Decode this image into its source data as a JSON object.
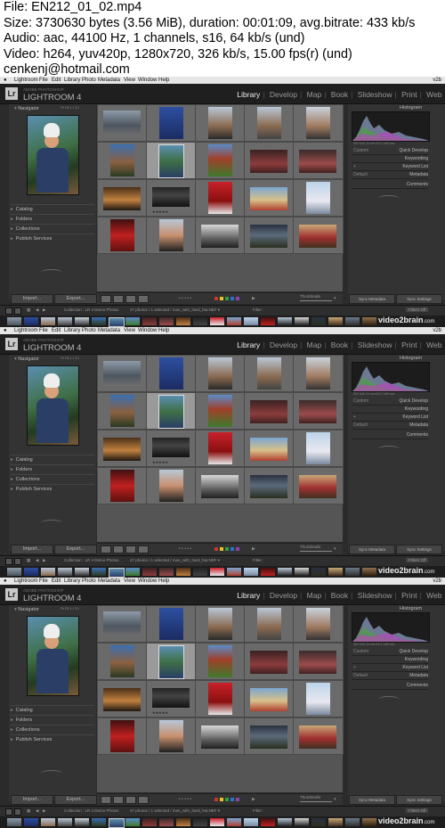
{
  "meta": {
    "lines": [
      "File: EN212_01_02.mp4",
      "Size: 3730630 bytes (3.56 MiB), duration: 00:01:09, avg.bitrate: 433 kb/s",
      "Audio: aac, 44100 Hz, 1 channels, s16, 64 kb/s (und)",
      "Video: h264, yuv420p, 1280x720, 326 kb/s, 15.00 fps(r) (und)",
      "cenkenj@hotmail.com"
    ]
  },
  "menubar": {
    "items": [
      "Lightroom",
      "File",
      "Edit",
      "Library",
      "Photo",
      "Metadata",
      "View",
      "Window",
      "Help"
    ],
    "right_text": "v2b"
  },
  "app": {
    "logo": "Lr",
    "brand_small": "ADOBE PHOTOSHOP",
    "brand": "LIGHTROOM 4",
    "modules": [
      "Library",
      "Develop",
      "Map",
      "Book",
      "Slideshow",
      "Print",
      "Web"
    ],
    "active_module": "Library"
  },
  "left_panel": {
    "navigator": "Navigator",
    "navigator_options": "Fit  Fill  1:1  3:1",
    "sections": [
      "Catalog",
      "Folders",
      "Collections",
      "Publish Services"
    ],
    "import": "Import...",
    "export": "Export..."
  },
  "right_panel": {
    "histogram": "Histogram",
    "histo_info": "ISO 640   24 mm   f/4.0   1/60 sec",
    "preset": "Custom",
    "default": "Default",
    "rows": [
      "Quick Develop",
      "Keywording",
      "Keyword List",
      "Metadata",
      "Comments"
    ],
    "sync_metadata": "Sync Metadata",
    "sync_settings": "Sync Settings"
  },
  "toolbar": {
    "thumbnails": "Thumbnails"
  },
  "status": {
    "page1": "1",
    "page2": "2",
    "collection": "Collection : LR 4 Demo Photos",
    "selected": "47 photos / 1 selected / man_with_hard_hat.NEF ▾",
    "filter": "Filter :",
    "filters_off": "Filters Off"
  },
  "watermark": {
    "text": "video2brain",
    "suffix": ".com"
  },
  "grid": {
    "stars": "★★★★★"
  },
  "colors": {
    "swatches": [
      "#c0392b",
      "#e6c22a",
      "#2e9e3e",
      "#2f6fc9",
      "#8e44ad"
    ]
  }
}
